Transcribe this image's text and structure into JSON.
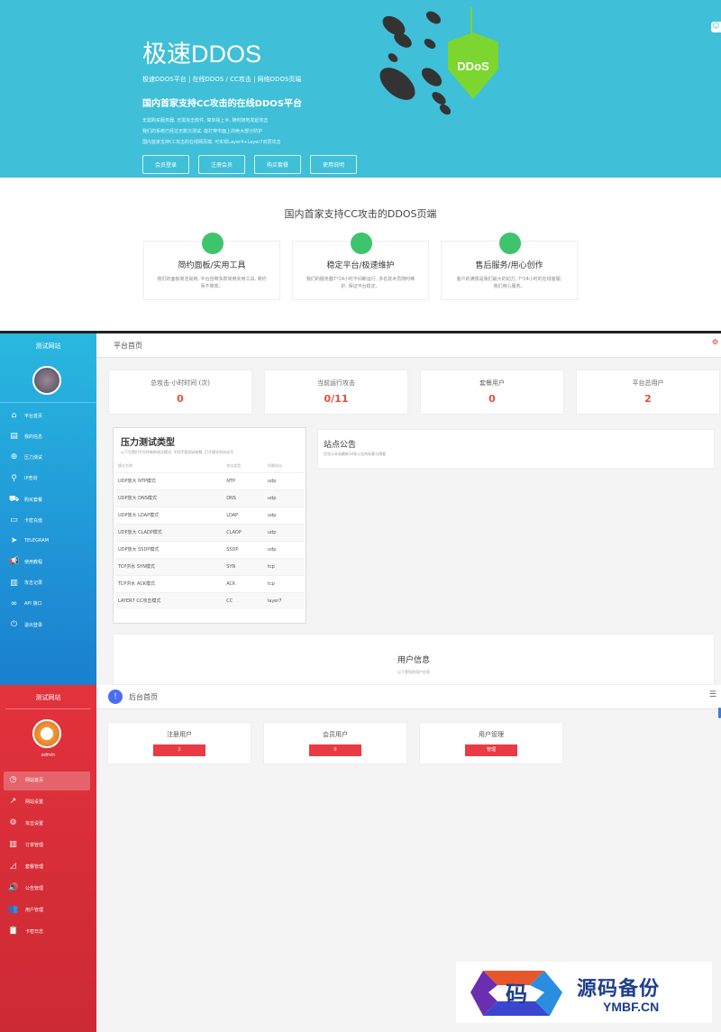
{
  "hero": {
    "title": "极速DDOS",
    "subtitle": "极速DDOS平台 | 在线DDOS / CC攻击 | 网络DDOS页端",
    "tagline": "国内首家支持CC攻击的在线DDOS平台",
    "desc_lines": [
      "无需购买服务器, 无需攻击软件, 简单易上手, 随时随地发起攻击",
      "我们的系统已经过无数次测试, 能打穿市面上的绝大部分防护",
      "国内首家支持CC攻击的在线网页端, 可实现Layer4+Layer7双层攻击"
    ],
    "buttons": [
      "会员登录",
      "注册会员",
      "购买套餐",
      "使用说明"
    ],
    "shield_text": "DDoS",
    "accent": "#3fbfd8"
  },
  "features": {
    "title": "国内首家支持CC攻击的DDOS页端",
    "cards": [
      {
        "title": "简约面板/实用工具",
        "desc": "我们的面板简洁易用, 平台自带多款常用实用工具, 简约而不简单。"
      },
      {
        "title": "稳定平台/极速维护",
        "desc": "我们的服务器7*24小时不间断运行, 多名技术员随时维护, 保证平台稳定。"
      },
      {
        "title": "售后服务/用心创作",
        "desc": "客户的满意是我们最大的动力, 7*24小时的在线客服, 我们用心服务。"
      }
    ]
  },
  "panel1": {
    "site_name": "测试网站",
    "menu": [
      {
        "icon": "home-icon",
        "glyph": "⌂",
        "label": "平台首页"
      },
      {
        "icon": "id-card-icon",
        "glyph": "▤",
        "label": "我的信息"
      },
      {
        "icon": "crosshair-icon",
        "glyph": "⊕",
        "label": "压力测试"
      },
      {
        "icon": "search-icon",
        "glyph": "⚲",
        "label": "IP查询"
      },
      {
        "icon": "cart-icon",
        "glyph": "⛟",
        "label": "购买套餐"
      },
      {
        "icon": "credit-card-icon",
        "glyph": "▭",
        "label": "卡密充值"
      },
      {
        "icon": "telegram-icon",
        "glyph": "➤",
        "label": "TELEGRAM"
      },
      {
        "icon": "megaphone-icon",
        "glyph": "📢",
        "label": "使用教程"
      },
      {
        "icon": "bar-chart-icon",
        "glyph": "▥",
        "label": "攻击记录"
      },
      {
        "icon": "link-icon",
        "glyph": "∞",
        "label": "API 接口"
      },
      {
        "icon": "power-icon",
        "glyph": "⏻",
        "label": "退出登录"
      }
    ],
    "page_title": "平台首页",
    "stats": [
      {
        "label": "总攻击·小时时间 (次)",
        "value": "0"
      },
      {
        "label": "当前运行攻击",
        "value": "0/11"
      },
      {
        "label": "套餐用户",
        "value": "0"
      },
      {
        "label": "平台总用户",
        "value": "2"
      }
    ],
    "pressure": {
      "title": "压力测试类型",
      "desc": "以下为我们平台所有的攻击模式, 不同手段测试参数, 打开模式的协议号",
      "headers": [
        "模式名称",
        "攻击类型",
        "所属协议"
      ],
      "rows": [
        [
          "UDP放大 NTP模式",
          "NTP",
          "udp"
        ],
        [
          "UDP放大 DNS模式",
          "DNS",
          "udp"
        ],
        [
          "UDP放大 LDAP模式",
          "LDAP",
          "udp"
        ],
        [
          "UDP放大 CLADP模式",
          "CLADP",
          "udp"
        ],
        [
          "UDP放大 SSDP模式",
          "SSDP",
          "udp"
        ],
        [
          "TCP洪水 SYN模式",
          "SYN",
          "tcp"
        ],
        [
          "TCP洪水 ACK模式",
          "ACK",
          "tcp"
        ],
        [
          "LAYER7 CC攻击模式",
          "CC",
          "layer7"
        ]
      ]
    },
    "notice": {
      "title": "站点公告",
      "desc": "仅显示本站最新10条公告的标题与摘要"
    },
    "userinfo": {
      "title": "用户信息",
      "desc": "以下是您的用户信息"
    }
  },
  "panel2": {
    "site_name": "测试网站",
    "username": "admin",
    "menu": [
      {
        "icon": "dashboard-icon",
        "glyph": "◷",
        "label": "网站首页"
      },
      {
        "icon": "trend-icon",
        "glyph": "↗",
        "label": "网站设置"
      },
      {
        "icon": "gear-icon",
        "glyph": "⚙",
        "label": "攻击设置"
      },
      {
        "icon": "bar-chart-icon",
        "glyph": "▥",
        "label": "订单管理"
      },
      {
        "icon": "area-chart-icon",
        "glyph": "◿",
        "label": "套餐管理"
      },
      {
        "icon": "speaker-icon",
        "glyph": "🔊",
        "label": "公告管理"
      },
      {
        "icon": "users-icon",
        "glyph": "👥",
        "label": "用户管理"
      },
      {
        "icon": "clipboard-icon",
        "glyph": "📋",
        "label": "卡密日志"
      }
    ],
    "page_title": "后台首页",
    "menu_glyph": "☰",
    "cards": [
      {
        "label": "注册用户",
        "button": "2"
      },
      {
        "label": "会员用户",
        "button": "0"
      },
      {
        "label": "用户管理",
        "button": "管理"
      }
    ]
  },
  "watermark": {
    "logo_char": "码",
    "cn": "源码备份",
    "en": "YMBF.CN"
  }
}
